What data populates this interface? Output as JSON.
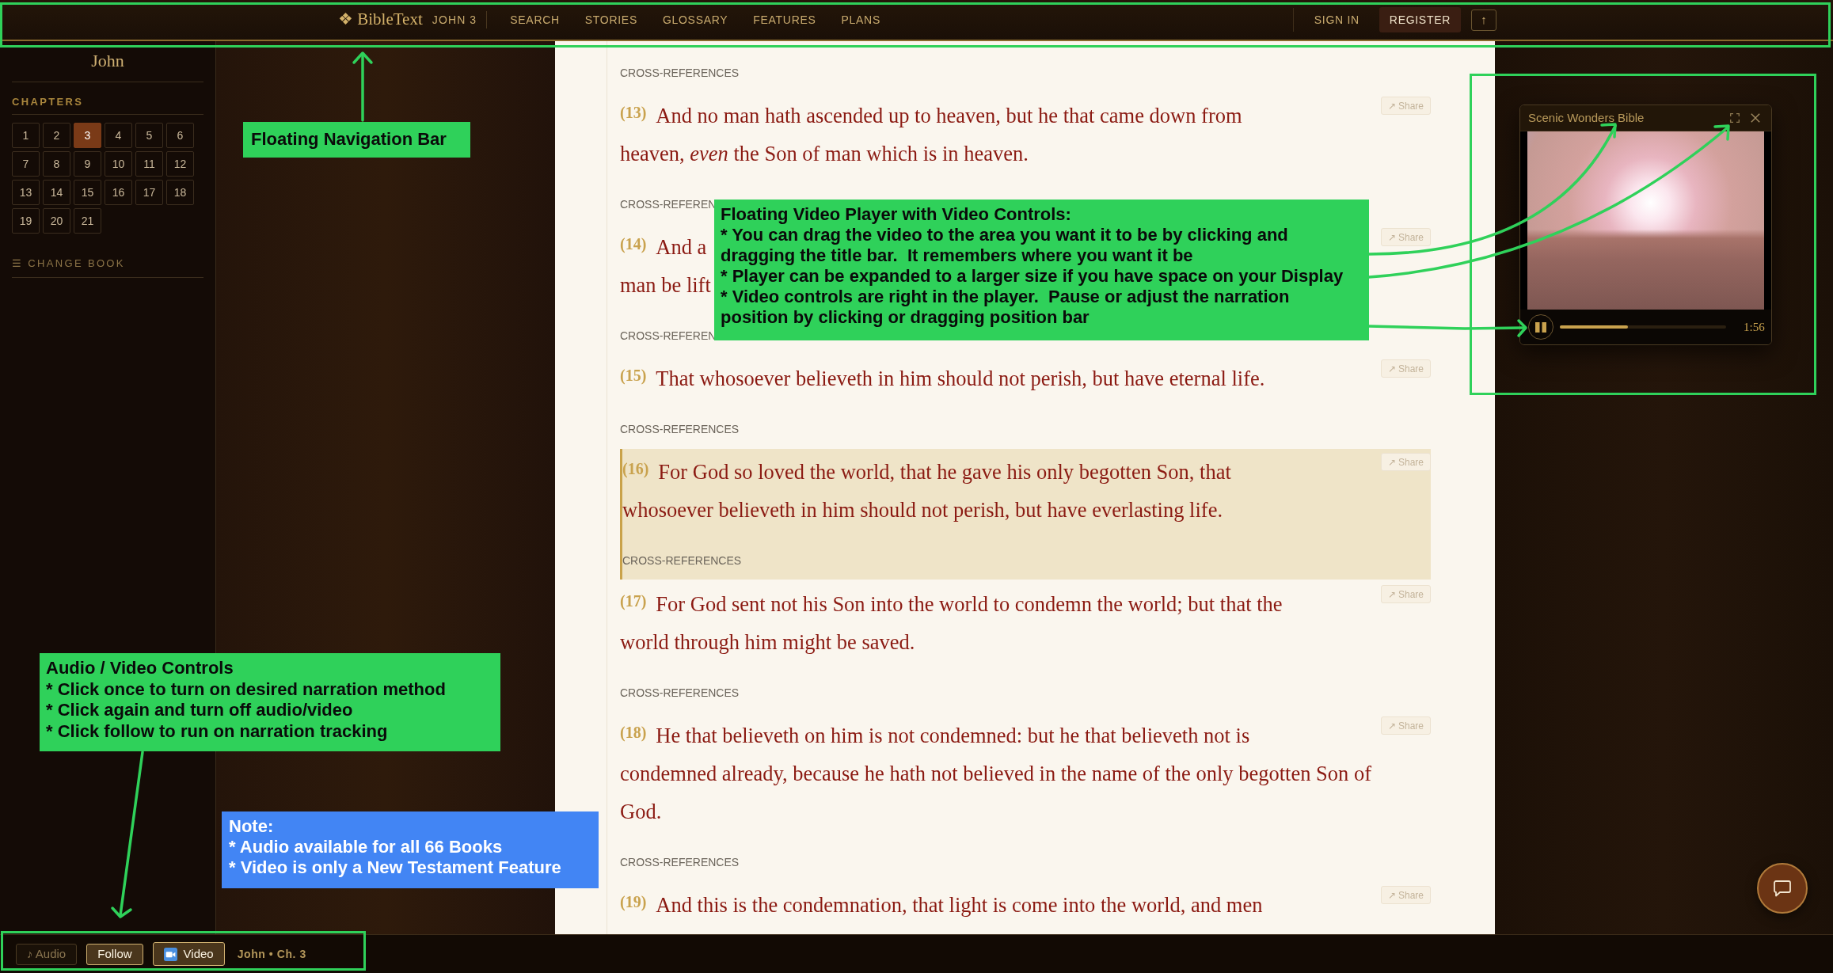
{
  "nav": {
    "logo": "❖ BibleText",
    "chapter_label": "JOHN 3",
    "links": [
      "SEARCH",
      "STORIES",
      "GLOSSARY",
      "FEATURES",
      "PLANS"
    ],
    "account": [
      {
        "label": "SIGN IN",
        "kind": "link"
      },
      {
        "label": "REGISTER",
        "kind": "button"
      }
    ],
    "scroll_top": "↑"
  },
  "sidebar": {
    "book_title": "John",
    "chapters_heading": "CHAPTERS",
    "chapters": [
      {
        "label": "1",
        "selected": false
      },
      {
        "label": "2",
        "selected": false
      },
      {
        "label": "3",
        "selected": true
      },
      {
        "label": "4",
        "selected": false
      },
      {
        "label": "5",
        "selected": false
      },
      {
        "label": "6",
        "selected": false
      },
      {
        "label": "7",
        "selected": false
      },
      {
        "label": "8",
        "selected": false
      },
      {
        "label": "9",
        "selected": false
      },
      {
        "label": "10",
        "selected": false
      },
      {
        "label": "11",
        "selected": false
      },
      {
        "label": "12",
        "selected": false
      },
      {
        "label": "13",
        "selected": false
      },
      {
        "label": "14",
        "selected": false
      },
      {
        "label": "15",
        "selected": false
      },
      {
        "label": "16",
        "selected": false
      },
      {
        "label": "17",
        "selected": false
      },
      {
        "label": "18",
        "selected": false
      },
      {
        "label": "19",
        "selected": false
      },
      {
        "label": "20",
        "selected": false
      },
      {
        "label": "21",
        "selected": false
      }
    ],
    "change_book": "☰ CHANGE BOOK"
  },
  "reader": {
    "top_cross_references": "CROSS-REFERENCES",
    "verses": [
      {
        "number": "(13)",
        "lines": [
          "And no man hath ascended up to heaven, but he that came down from",
          "heaven, *even* the Son of man which is in heaven."
        ],
        "share": "↗ Share",
        "highlighted": false,
        "cross_references": "CROSS-REFEREN"
      },
      {
        "number": "(14)",
        "lines": [
          "And a",
          "man be lift"
        ],
        "share": "↗ Share",
        "highlighted": false,
        "cross_references": "CROSS-REFEREN"
      },
      {
        "number": "(15)",
        "lines": [
          "That whosoever believeth in him should not perish, but have eternal life."
        ],
        "share": "↗ Share",
        "highlighted": false,
        "cross_references": "CROSS-REFERENCES"
      },
      {
        "number": "(16)",
        "lines": [
          "For God so loved the world, that he gave his only begotten Son, that",
          "whosoever believeth in him should not perish, but have everlasting life."
        ],
        "share": "↗ Share",
        "highlighted": true,
        "cross_references": "CROSS-REFERENCES"
      },
      {
        "number": "(17)",
        "lines": [
          "For God sent not his Son into the world to condemn the world; but that the",
          "world through him might be saved."
        ],
        "share": "↗ Share",
        "highlighted": false,
        "cross_references": "CROSS-REFERENCES"
      },
      {
        "number": "(18)",
        "lines": [
          "He that believeth on him is not condemned: but he that believeth not is",
          "condemned already, because he hath not believed in the name of the only begotten Son of",
          "God."
        ],
        "share": "↗ Share",
        "highlighted": false,
        "cross_references": "CROSS-REFERENCES"
      },
      {
        "number": "(19)",
        "lines": [
          "And this is the condemnation, that light is come into the world, and men"
        ],
        "share": "↗ Share",
        "highlighted": false
      }
    ]
  },
  "video_player": {
    "title": "Scenic Wonders Bible",
    "playing": true,
    "level": 0.41,
    "time": "1:56"
  },
  "playback_bar": {
    "buttons": [
      {
        "label": "♪ Audio",
        "kind": "text",
        "active": false
      },
      {
        "label": "Follow",
        "kind": "text",
        "active": true
      },
      {
        "label": "Video",
        "kind": "icon",
        "active": true
      }
    ],
    "location": "John • Ch. 3"
  },
  "annotations": [
    {
      "color": "#2fd15a",
      "lines": [
        "Floating Navigation Bar"
      ]
    },
    {
      "color": "#2fd15a",
      "lines": [
        "Floating Video Player with Video Controls:",
        "* You can drag the video to the area you want it to be by clicking and",
        "dragging the title bar.  It remembers where you want it be",
        "* Player can be expanded to a larger size if you have space on your Display",
        "* Video controls are right in the player.  Pause or adjust the narration",
        "position by clicking or dragging position bar"
      ]
    },
    {
      "color": "#2fd15a",
      "lines": [
        "Audio / Video Controls",
        "* Click once to turn on desired narration method",
        "* Click again and turn off audio/video",
        "* Click follow to run on narration tracking"
      ]
    },
    {
      "color": "#4285f4",
      "lines": [
        "Note:",
        "* Audio available for all 66 Books",
        "* Video is only a New Testament Feature"
      ]
    }
  ]
}
